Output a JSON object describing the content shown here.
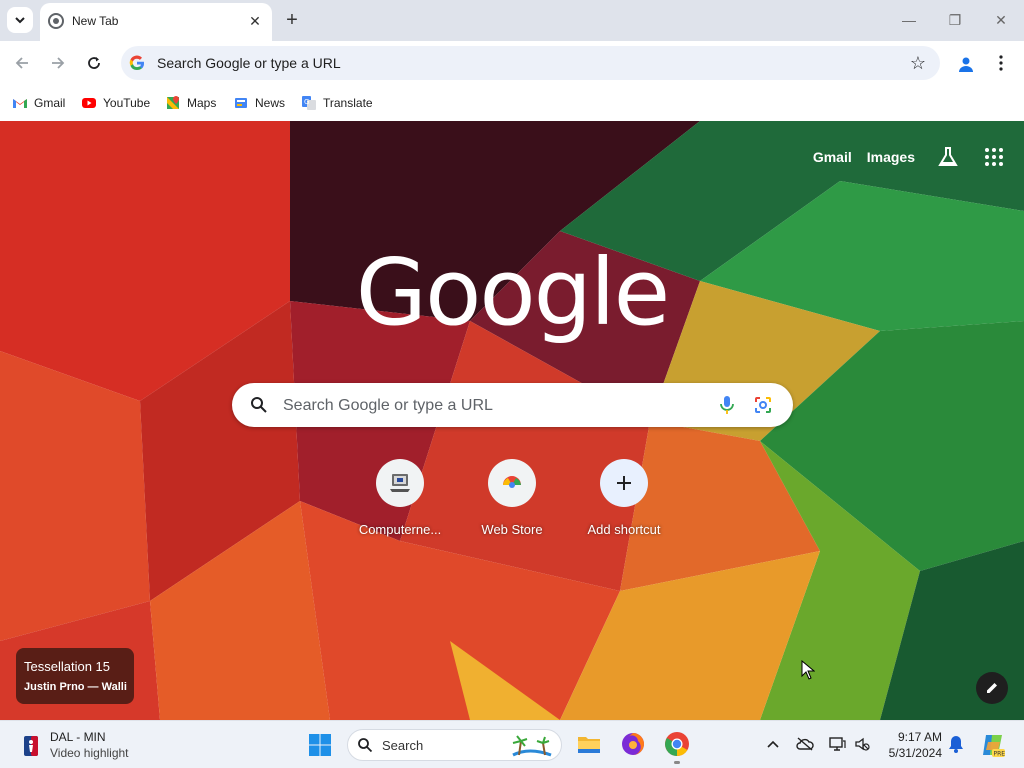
{
  "tabstrip": {
    "tab_title": "New Tab",
    "close_glyph": "✕",
    "newtab_glyph": "+",
    "window_controls": [
      "—",
      "❐",
      "✕"
    ]
  },
  "toolbar": {
    "omnibox_text": "Search Google or type a URL"
  },
  "bookmarks": [
    {
      "label": "Gmail",
      "icon": "gmail-icon"
    },
    {
      "label": "YouTube",
      "icon": "youtube-icon"
    },
    {
      "label": "Maps",
      "icon": "maps-icon"
    },
    {
      "label": "News",
      "icon": "news-icon"
    },
    {
      "label": "Translate",
      "icon": "translate-icon"
    }
  ],
  "ntp": {
    "top_links": [
      "Gmail",
      "Images"
    ],
    "logo": "Google",
    "search_placeholder": "Search Google or type a URL",
    "shortcuts": [
      {
        "label": "Computerne...",
        "icon": "computer-icon"
      },
      {
        "label": "Web Store",
        "icon": "webstore-icon"
      },
      {
        "label": "Add shortcut",
        "icon": "plus-icon"
      }
    ],
    "attribution_title": "Tessellation 15",
    "attribution_author": "Justin Prno — Walli"
  },
  "taskbar": {
    "widget_line1": "DAL - MIN",
    "widget_line2": "Video highlight",
    "search_label": "Search",
    "time": "9:17 AM",
    "date": "5/31/2024"
  },
  "colors": {
    "tabstrip_bg": "#dfe3eb",
    "omnibox_bg": "#edf1f9",
    "taskbar_bg": "#eef2f8"
  }
}
